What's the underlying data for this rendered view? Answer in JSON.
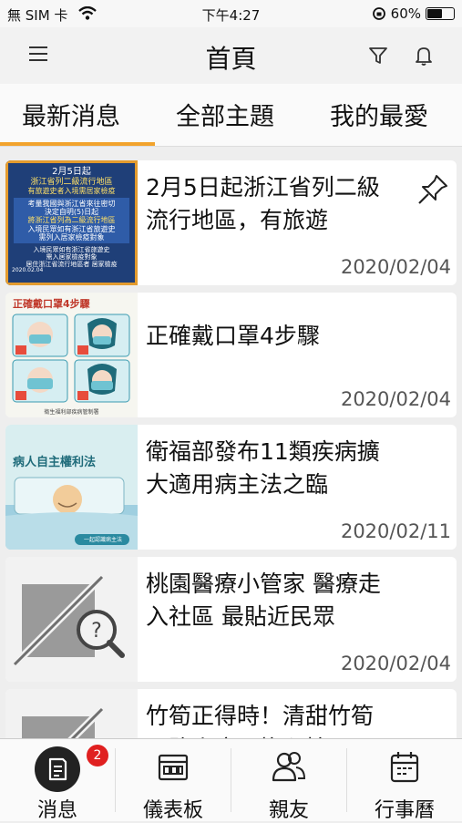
{
  "status": {
    "carrier": "無 SIM 卡",
    "time": "下午4:27",
    "battery_text": "60%",
    "battery_level": 0.6
  },
  "header": {
    "title": "首頁",
    "left_icon": "menu-icon",
    "right_icons": [
      "filter-icon",
      "bell-icon"
    ]
  },
  "tabs": [
    {
      "label": "最新消息",
      "active": true
    },
    {
      "label": "全部主題",
      "active": false
    },
    {
      "label": "我的最愛",
      "active": false
    }
  ],
  "accent_color": "#f2a32c",
  "articles": [
    {
      "title": "2月5日起浙江省列二級流行地區，有旅遊",
      "date": "2020/02/04",
      "pinned": true,
      "thumb": {
        "head": "2月5日起",
        "line2": "浙江省列二級流行地區",
        "line3": "有旅遊史者入境需居家檢疫",
        "line4": "考量我國與浙江省來往密切",
        "line5": "決定自明(5)日起",
        "line6": "將浙江省列為二級流行地區",
        "line7": "入境民眾如有浙江省旅遊史",
        "line8": "需列入居家檢疫對象",
        "line9": "入境民眾如有浙江省旅遊史",
        "line10": "需入居家檢疫對象",
        "line11": "居住浙江省流行地區者 居家檢疫",
        "date": "2020.02.04"
      }
    },
    {
      "title": "正確戴口罩4步驟",
      "date": "2020/02/04",
      "pinned": false,
      "thumb": {
        "head": "正確戴口罩4步驟",
        "footer": "衛生福利部疾病管制署"
      }
    },
    {
      "title": "衛福部發布11類疾病擴大適用病主法之臨",
      "date": "2020/02/11",
      "pinned": false,
      "thumb": {
        "head": "病人自主權利法",
        "button": "一起認識病主法"
      }
    },
    {
      "title": "桃園醫療小管家 醫療走入社區 最貼近民眾",
      "date": "2020/02/04",
      "pinned": false,
      "thumb": null
    },
    {
      "title": "竹筍正得時！清甜竹筍退路火麼，擔心糖",
      "date": "",
      "pinned": false,
      "thumb": null
    }
  ],
  "tabbar": [
    {
      "label": "消息",
      "icon": "news-icon",
      "active": true,
      "badge": "2"
    },
    {
      "label": "儀表板",
      "icon": "dashboard-icon",
      "active": false,
      "badge": ""
    },
    {
      "label": "親友",
      "icon": "friends-icon",
      "active": false,
      "badge": ""
    },
    {
      "label": "行事曆",
      "icon": "calendar-icon",
      "active": false,
      "badge": ""
    }
  ]
}
